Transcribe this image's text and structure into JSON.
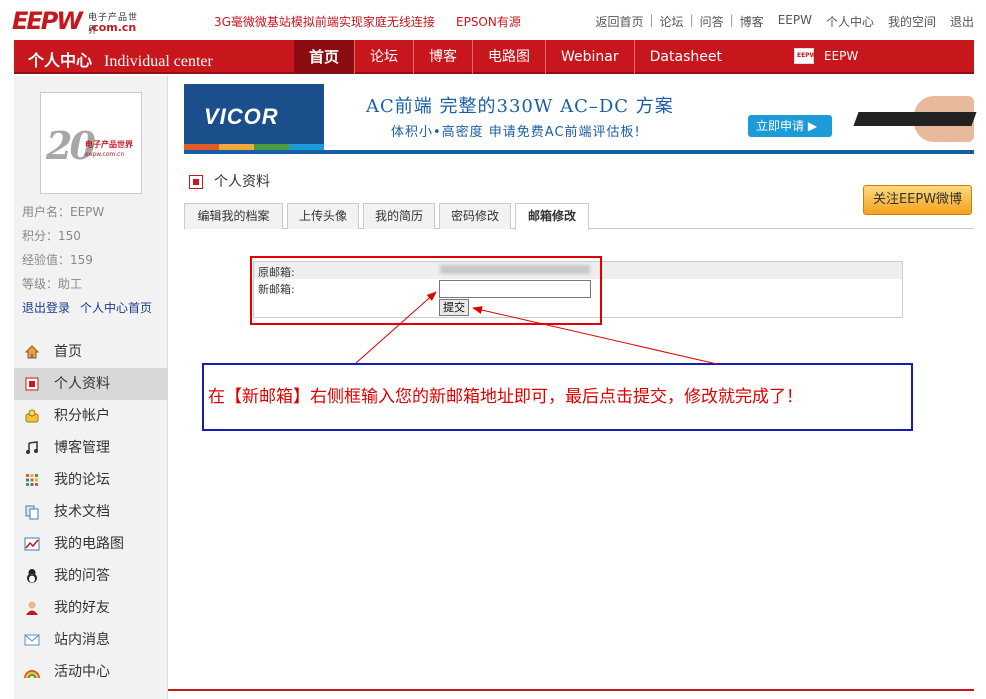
{
  "topbar": {
    "logo_big": "EEPW",
    "logo_small1": "电子产品世界",
    "logo_small2": ".com.cn",
    "promo1": "3G毫微微基站模拟前端实现家庭无线连接",
    "promo2": "EPSON有源",
    "nav": [
      "返回首页",
      "论坛",
      "问答",
      "博客",
      "EEPW",
      "个人中心",
      "我的空间",
      "退出"
    ]
  },
  "rednav": {
    "title_cn": "个人中心",
    "title_en": "Individual center",
    "items": [
      "首页",
      "论坛",
      "博客",
      "电路图",
      "Webinar",
      "Datasheet"
    ],
    "active_item": "首页",
    "eepw_label": "EEPW",
    "eepw_icon_text": "EEPW"
  },
  "sidebar": {
    "avatar": {
      "num": "20",
      "cn": "电子产品世界",
      "url": "eepw.com.cn"
    },
    "username_label": "用户名：",
    "username": "EEPW",
    "points_label": "积分：",
    "points": "150",
    "exp_label": "经验值：",
    "exp": "159",
    "level_label": "等级：",
    "level": "助工",
    "logout": "退出登录",
    "home_link": "个人中心首页",
    "menu": [
      {
        "label": "首页",
        "icon": "home-icon"
      },
      {
        "label": "个人资料",
        "icon": "profile-icon"
      },
      {
        "label": "积分帐户",
        "icon": "points-icon"
      },
      {
        "label": "博客管理",
        "icon": "blog-icon"
      },
      {
        "label": "我的论坛",
        "icon": "forum-icon"
      },
      {
        "label": "技术文档",
        "icon": "document-icon"
      },
      {
        "label": "我的电路图",
        "icon": "circuit-icon"
      },
      {
        "label": "我的问答",
        "icon": "qa-icon"
      },
      {
        "label": "我的好友",
        "icon": "friends-icon"
      },
      {
        "label": "站内消息",
        "icon": "mail-icon"
      },
      {
        "label": "活动中心",
        "icon": "rainbow-icon"
      }
    ],
    "active_index": 1
  },
  "banner": {
    "brand": "VICOR",
    "headline": "AC前端  完整的330W  AC–DC  方案",
    "subline": "体积小•高密度    申请免费AC前端评估板!",
    "apply_button": "立即申请 ▶"
  },
  "section": {
    "title": "个人资料",
    "follow_button": "关注EEPW微博"
  },
  "tabs": [
    "编辑我的档案",
    "上传头像",
    "我的简历",
    "密码修改",
    "邮箱修改"
  ],
  "active_tab": 4,
  "form": {
    "old_email_label": "原邮箱:",
    "new_email_label": "新邮箱:",
    "new_email_value": "",
    "submit_label": "提交"
  },
  "annotation": {
    "text": "在【新邮箱】右侧框输入您的新邮箱地址即可，最后点击提交，修改就完成了！",
    "highlight_color": "#e00000",
    "callout_border_color": "#1a1ab5"
  },
  "colors": {
    "brand_red": "#c8161d",
    "brand_blue": "#1a5fa4"
  }
}
